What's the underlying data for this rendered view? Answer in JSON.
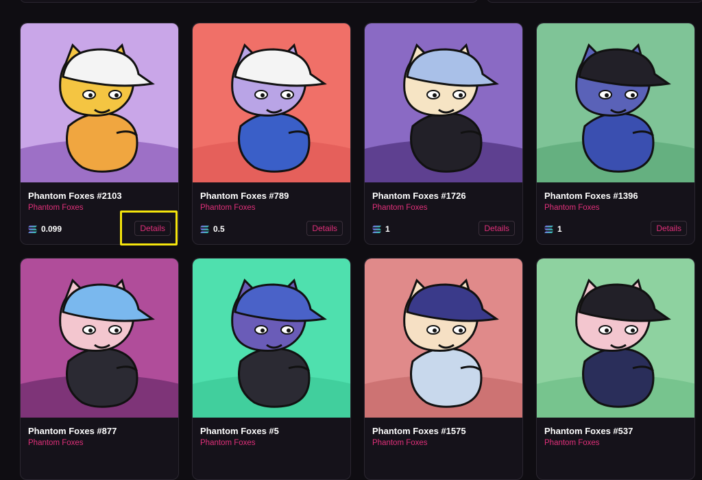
{
  "cards": [
    {
      "title": "Phantom Foxes #2103",
      "collection": "Phantom Foxes",
      "price": "0.099",
      "details_label": "Details",
      "bg": "#c9a6e8",
      "bg2": "#8a5ab8",
      "fur": "#f4c542",
      "body": "#f0a640",
      "hat": "#f4f4f4"
    },
    {
      "title": "Phantom Foxes #789",
      "collection": "Phantom Foxes",
      "price": "0.5",
      "details_label": "Details",
      "bg": "#f07068",
      "bg2": "#e05a55",
      "fur": "#b9a4e6",
      "body": "#3a5fc8",
      "hat": "#f4f4f4"
    },
    {
      "title": "Phantom Foxes #1726",
      "collection": "Phantom Foxes",
      "price": "1",
      "details_label": "Details",
      "bg": "#8a6ac4",
      "bg2": "#4b2f7a",
      "fur": "#f6e4c4",
      "body": "#222028",
      "hat": "#a9c0e8"
    },
    {
      "title": "Phantom Foxes #1396",
      "collection": "Phantom Foxes",
      "price": "1",
      "details_label": "Details",
      "bg": "#7fc497",
      "bg2": "#5aa876",
      "fur": "#5a62b8",
      "body": "#3a4fb0",
      "hat": "#222028"
    },
    {
      "title": "Phantom Foxes #877",
      "collection": "Phantom Foxes",
      "price": "",
      "details_label": "",
      "bg": "#b04d9a",
      "bg2": "#6a2a6a",
      "fur": "#f3c6cf",
      "body": "#2b2a33",
      "hat": "#7ab8ee"
    },
    {
      "title": "Phantom Foxes #5",
      "collection": "Phantom Foxes",
      "price": "",
      "details_label": "",
      "bg": "#4fe0ae",
      "bg2": "#3cc896",
      "fur": "#6a5cb8",
      "body": "#2b2a33",
      "hat": "#4a62c8"
    },
    {
      "title": "Phantom Foxes #1575",
      "collection": "Phantom Foxes",
      "price": "",
      "details_label": "",
      "bg": "#e08a8a",
      "bg2": "#c46a6a",
      "fur": "#f6e0c4",
      "body": "#c8d8ec",
      "hat": "#3a3a8a"
    },
    {
      "title": "Phantom Foxes #537",
      "collection": "Phantom Foxes",
      "price": "",
      "details_label": "",
      "bg": "#8ed2a0",
      "bg2": "#6ebd86",
      "fur": "#f3c6cf",
      "body": "#2a2e5a",
      "hat": "#222028"
    }
  ],
  "colors": {
    "accent": "#e1307a",
    "highlight": "#f5e50c",
    "page_bg": "#0f0d12",
    "card_bg": "#15121a"
  }
}
